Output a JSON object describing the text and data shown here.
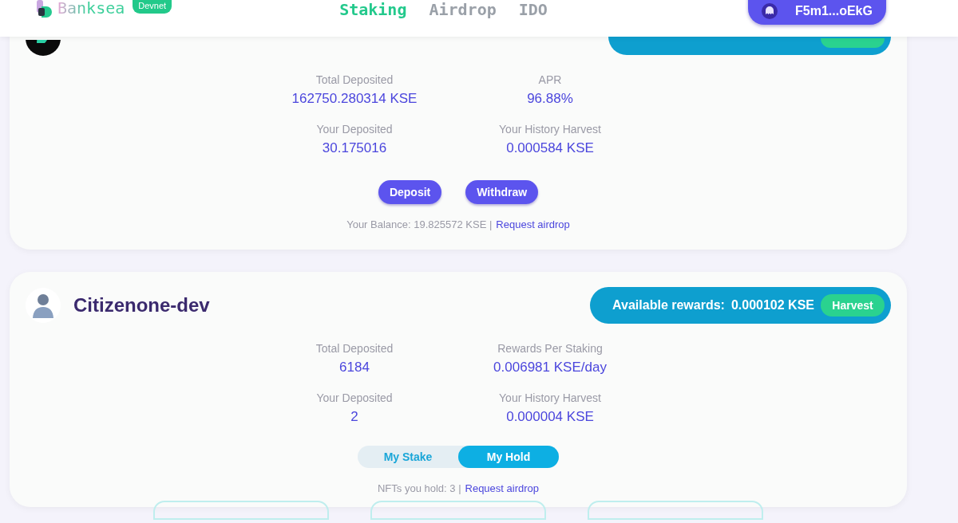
{
  "header": {
    "logo": "Banksea",
    "badge": "Devnet",
    "nav": [
      {
        "label": "Staking",
        "selected": true
      },
      {
        "label": "Airdrop",
        "selected": false
      },
      {
        "label": "IDO",
        "selected": false
      }
    ],
    "wallet": "F5m1...oEkG"
  },
  "pools": [
    {
      "kind": "token",
      "stats": [
        {
          "label": "Total Deposited",
          "value": "162750.280314 KSE"
        },
        {
          "label": "APR",
          "value": "96.88%"
        },
        {
          "label": "Your Deposited",
          "value": "30.175016"
        },
        {
          "label": "Your History Harvest",
          "value": "0.000584 KSE"
        }
      ],
      "actions": [
        "Deposit",
        "Withdraw"
      ],
      "footer": {
        "text": "Your Balance: 19.825572 KSE |",
        "link": "Request airdrop"
      }
    },
    {
      "kind": "nft",
      "name": "Citizenone-dev",
      "rewards_label": "Available rewards:",
      "rewards": "0.000102 KSE",
      "harvest": "Harvest",
      "stats": [
        {
          "label": "Total Deposited",
          "value": "6184"
        },
        {
          "label": "Rewards Per Staking",
          "value": "0.006981 KSE/day"
        },
        {
          "label": "Your Deposited",
          "value": "2"
        },
        {
          "label": "Your History Harvest",
          "value": "0.000004 KSE"
        }
      ],
      "toggle": [
        {
          "label": "My Stake",
          "selected": false
        },
        {
          "label": "My Hold",
          "selected": true
        }
      ],
      "footer": {
        "text": "NFTs you hold: 3 |",
        "link": "Request airdrop"
      }
    }
  ]
}
